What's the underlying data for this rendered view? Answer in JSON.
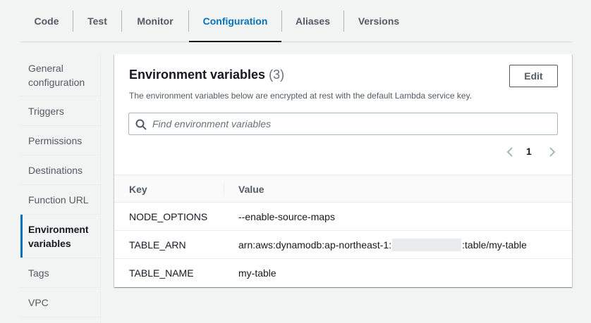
{
  "tabs": [
    {
      "label": "Code"
    },
    {
      "label": "Test"
    },
    {
      "label": "Monitor"
    },
    {
      "label": "Configuration"
    },
    {
      "label": "Aliases"
    },
    {
      "label": "Versions"
    }
  ],
  "sidebar": {
    "items": [
      {
        "label": "General configuration"
      },
      {
        "label": "Triggers"
      },
      {
        "label": "Permissions"
      },
      {
        "label": "Destinations"
      },
      {
        "label": "Function URL"
      },
      {
        "label": "Environment variables"
      },
      {
        "label": "Tags"
      },
      {
        "label": "VPC"
      }
    ]
  },
  "panel": {
    "title": "Environment variables",
    "count": "(3)",
    "description": "The environment variables below are encrypted at rest with the default Lambda service key.",
    "edit_label": "Edit",
    "search_placeholder": "Find environment variables",
    "page_number": "1"
  },
  "table": {
    "headers": {
      "key": "Key",
      "value": "Value"
    },
    "rows": [
      {
        "key": "NODE_OPTIONS",
        "value": "--enable-source-maps"
      },
      {
        "key": "TABLE_ARN",
        "value_prefix": "arn:aws:dynamodb:ap-northeast-1:",
        "value_suffix": ":table/my-table"
      },
      {
        "key": "TABLE_NAME",
        "value": "my-table"
      }
    ]
  },
  "colors": {
    "accent": "#0073bb",
    "text": "#16191f",
    "muted": "#545b64"
  }
}
